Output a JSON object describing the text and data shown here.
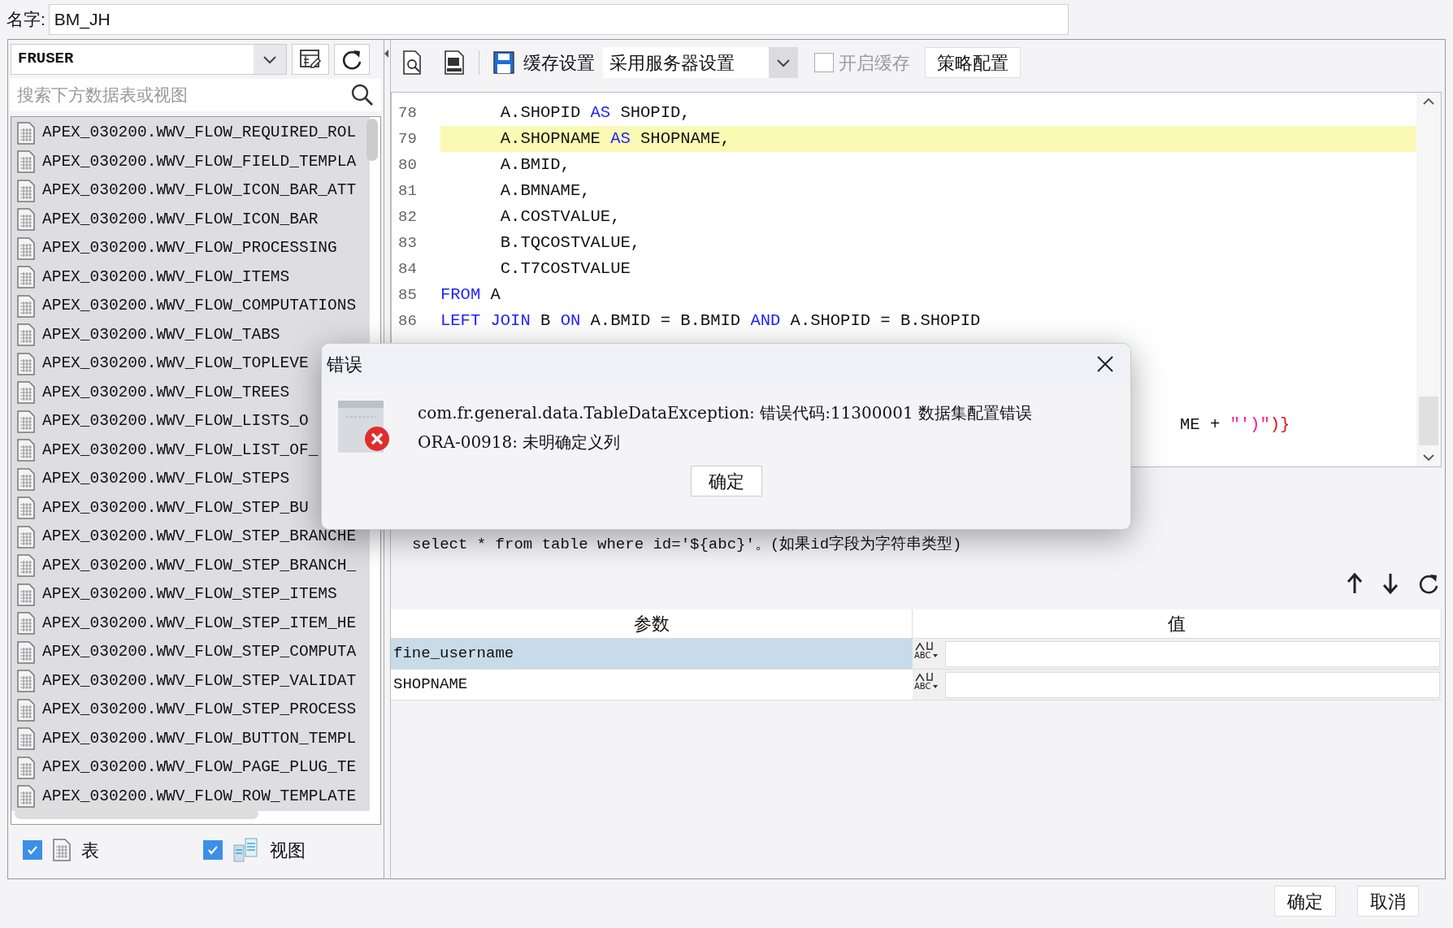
{
  "name_field": {
    "label": "名字:",
    "value": "BM_JH"
  },
  "schema_select": {
    "value": "FRUSER"
  },
  "table_search": {
    "placeholder": "搜索下方数据表或视图"
  },
  "tables": [
    "APEX_030200.WWV_FLOW_REQUIRED_ROL",
    "APEX_030200.WWV_FLOW_FIELD_TEMPLA",
    "APEX_030200.WWV_FLOW_ICON_BAR_ATT",
    "APEX_030200.WWV_FLOW_ICON_BAR",
    "APEX_030200.WWV_FLOW_PROCESSING",
    "APEX_030200.WWV_FLOW_ITEMS",
    "APEX_030200.WWV_FLOW_COMPUTATIONS",
    "APEX_030200.WWV_FLOW_TABS",
    "APEX_030200.WWV_FLOW_TOPLEVE",
    "APEX_030200.WWV_FLOW_TREES",
    "APEX_030200.WWV_FLOW_LISTS_O",
    "APEX_030200.WWV_FLOW_LIST_OF_",
    "APEX_030200.WWV_FLOW_STEPS",
    "APEX_030200.WWV_FLOW_STEP_BU",
    "APEX_030200.WWV_FLOW_STEP_BRANCHE",
    "APEX_030200.WWV_FLOW_STEP_BRANCH_",
    "APEX_030200.WWV_FLOW_STEP_ITEMS",
    "APEX_030200.WWV_FLOW_STEP_ITEM_HE",
    "APEX_030200.WWV_FLOW_STEP_COMPUTA",
    "APEX_030200.WWV_FLOW_STEP_VALIDAT",
    "APEX_030200.WWV_FLOW_STEP_PROCESS",
    "APEX_030200.WWV_FLOW_BUTTON_TEMPL",
    "APEX_030200.WWV_FLOW_PAGE_PLUG_TE",
    "APEX_030200.WWV_FLOW_ROW_TEMPLATE"
  ],
  "filters": [
    {
      "label": "表",
      "kind": "table",
      "checked": true
    },
    {
      "label": "视图",
      "kind": "view",
      "checked": true
    }
  ],
  "toolbar": {
    "cache_label": "缓存设置",
    "cache_select": "采用服务器设置",
    "enable_cache": {
      "label": "开启缓存",
      "checked": false,
      "disabled": true
    },
    "strategy_button": "策略配置"
  },
  "editor": {
    "lines": [
      {
        "kind": "code",
        "number": "78",
        "current": false,
        "tokens": [
          {
            "text": "      A.SHOPID ",
            "kind": "plain"
          },
          {
            "text": "AS",
            "kind": "keyword"
          },
          {
            "text": " SHOPID,",
            "kind": "plain"
          }
        ]
      },
      {
        "kind": "code",
        "number": "79",
        "current": true,
        "tokens": [
          {
            "text": "      A.SHOPNAME ",
            "kind": "plain"
          },
          {
            "text": "AS",
            "kind": "keyword"
          },
          {
            "text": " SHOPNAME,",
            "kind": "plain"
          }
        ]
      },
      {
        "kind": "code",
        "number": "80",
        "current": false,
        "tokens": [
          {
            "text": "      A.BMID,",
            "kind": "plain"
          }
        ]
      },
      {
        "kind": "code",
        "number": "81",
        "current": false,
        "tokens": [
          {
            "text": "      A.BMNAME,",
            "kind": "plain"
          }
        ]
      },
      {
        "kind": "code",
        "number": "82",
        "current": false,
        "tokens": [
          {
            "text": "      A.COSTVALUE,",
            "kind": "plain"
          }
        ]
      },
      {
        "kind": "code",
        "number": "83",
        "current": false,
        "tokens": [
          {
            "text": "      B.TQCOSTVALUE,",
            "kind": "plain"
          }
        ]
      },
      {
        "kind": "code",
        "number": "84",
        "current": false,
        "tokens": [
          {
            "text": "      C.T7COSTVALUE",
            "kind": "plain"
          }
        ]
      },
      {
        "kind": "code",
        "number": "85",
        "current": false,
        "tokens": [
          {
            "text": "FROM",
            "kind": "keyword"
          },
          {
            "text": " A",
            "kind": "plain"
          }
        ]
      },
      {
        "kind": "code",
        "number": "86",
        "current": false,
        "tokens": [
          {
            "text": "LEFT JOIN",
            "kind": "keyword"
          },
          {
            "text": " B ",
            "kind": "plain"
          },
          {
            "text": "ON",
            "kind": "keyword"
          },
          {
            "text": " A.BMID = B.BMID ",
            "kind": "plain"
          },
          {
            "text": "AND",
            "kind": "keyword"
          },
          {
            "text": " A.SHOPID = B.SHOPID",
            "kind": "plain"
          }
        ]
      },
      {
        "kind": "covered"
      },
      {
        "kind": "covered"
      },
      {
        "kind": "covered"
      },
      {
        "kind": "fragment",
        "tokens": [
          {
            "text": "ME + ",
            "kind": "plain"
          },
          {
            "text": "\"')\"",
            "kind": "string"
          },
          {
            "text": ")}",
            "kind": "brace"
          }
        ]
      }
    ]
  },
  "hint_lines": [
    "select * from table where id='${abc}'。(如果id字段为字符串类型)"
  ],
  "params": {
    "columns": [
      "参数",
      "值"
    ],
    "rows": [
      {
        "name": "fine_username",
        "selected": true,
        "type_label": "ABC"
      },
      {
        "name": "SHOPNAME",
        "selected": false,
        "type_label": "ABC"
      }
    ]
  },
  "buttons": [
    "确定",
    "取消"
  ],
  "dialog": {
    "title": "错误",
    "message_lines": [
      "com.fr.general.data.TableDataException: 错误代码:11300001 数据集配置错误",
      "ORA-00918: 未明确定义列"
    ],
    "button": "确定"
  }
}
